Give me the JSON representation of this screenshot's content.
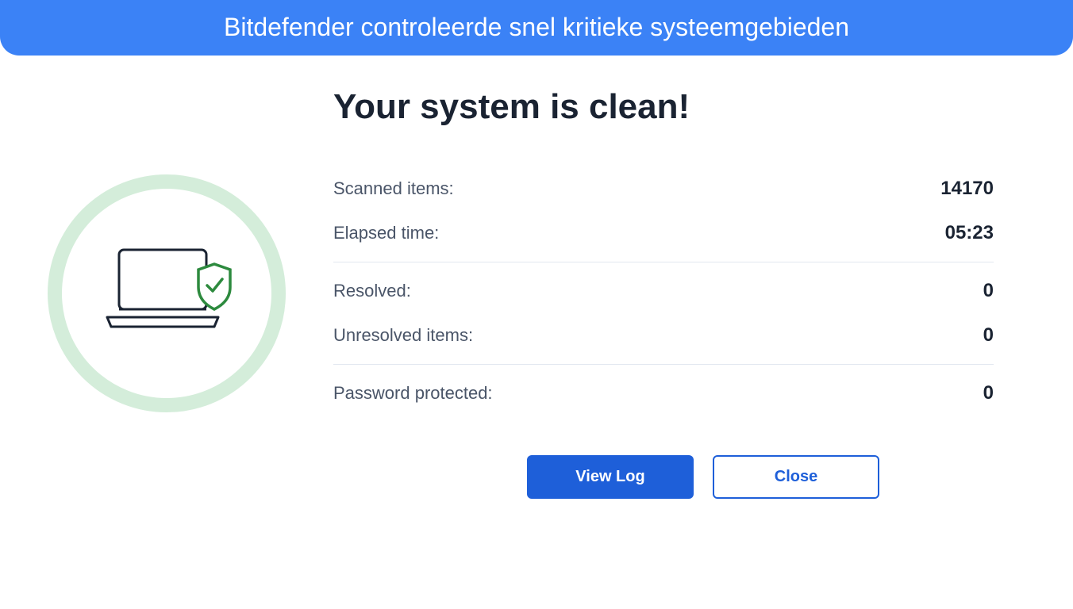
{
  "banner": {
    "text": "Bitdefender controleerde snel kritieke systeemgebieden"
  },
  "result": {
    "title": "Your system is clean!",
    "stats": {
      "scanned_items_label": "Scanned items:",
      "scanned_items_value": "14170",
      "elapsed_time_label": "Elapsed time:",
      "elapsed_time_value": "05:23",
      "resolved_label": "Resolved:",
      "resolved_value": "0",
      "unresolved_label": "Unresolved items:",
      "unresolved_value": "0",
      "password_protected_label": "Password protected:",
      "password_protected_value": "0"
    }
  },
  "buttons": {
    "view_log": "View Log",
    "close": "Close"
  }
}
